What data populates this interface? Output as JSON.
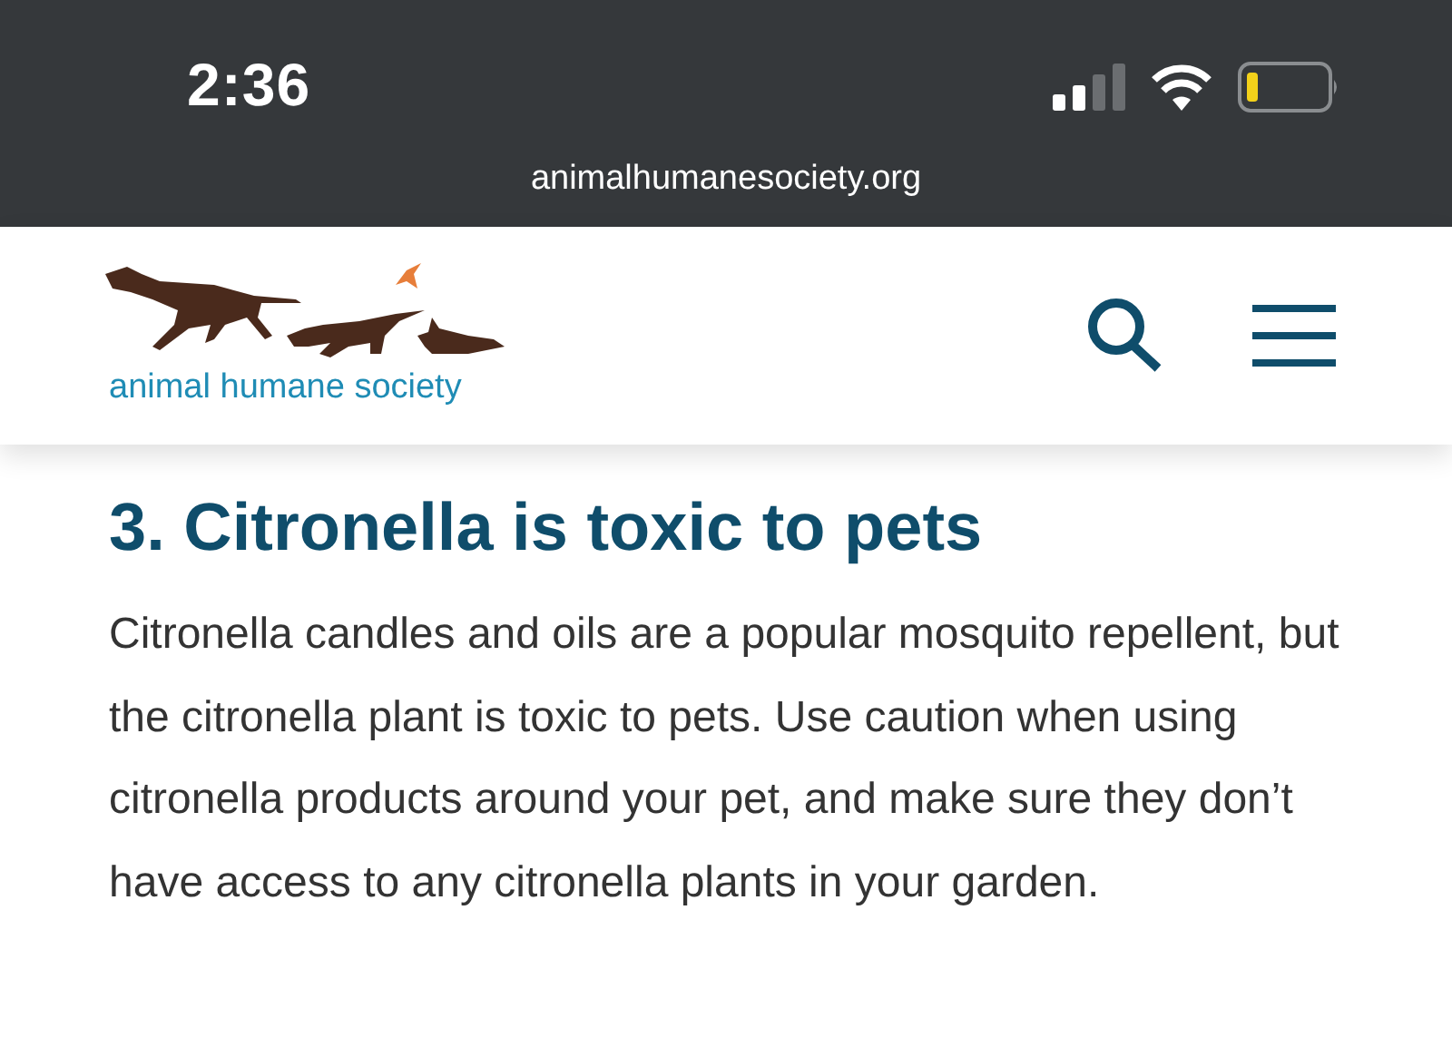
{
  "status_bar": {
    "time": "2:36",
    "url": "animalhumanesociety.org"
  },
  "header": {
    "logo_text": "animal humane society"
  },
  "article": {
    "heading": "3. Citronella is toxic to pets",
    "paragraph": "Citronella candles and oils are a popular mosquito repellent, but the citronella plant is toxic to pets. Use caution when using citronella products around your pet, and make sure they don’t have access to any citronella plants in your garden."
  }
}
